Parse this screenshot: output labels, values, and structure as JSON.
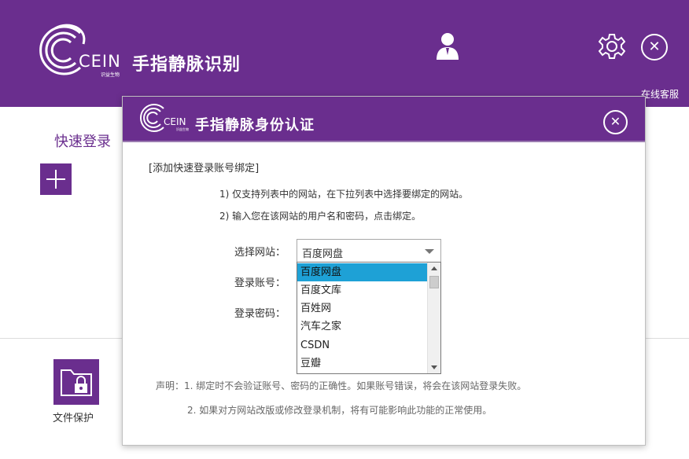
{
  "main": {
    "logo_text": "CEIN",
    "logo_sub": "识益生物",
    "title": "手指静脉识别",
    "online_service": "在线客服",
    "quick_login": "快速登录",
    "file_protection": "文件保护"
  },
  "modal": {
    "logo_text": "CEIN",
    "logo_sub": "识益生物",
    "title": "手指静脉身份认证",
    "section_title": "[添加快速登录账号绑定]",
    "instructions": [
      "1) 仅支持列表中的网站，在下拉列表中选择要绑定的网站。",
      "2) 输入您在该网站的用户名和密码，点击绑定。"
    ],
    "form": {
      "site_label": "选择网站：",
      "account_label": "登录账号：",
      "password_label": "登录密码：",
      "site_selected": "百度网盘",
      "site_options": [
        "百度网盘",
        "百度文库",
        "百姓网",
        "汽车之家",
        "CSDN",
        "豆瓣"
      ]
    },
    "notes": [
      "声明：1. 绑定时不会验证账号、密码的正确性。如果账号错误，将会在该网站登录失败。",
      "2. 如果对方网站改版或修改登录机制，将有可能影响此功能的正常使用。"
    ]
  },
  "colors": {
    "brand_purple": "#6a2e8e",
    "selection_blue": "#1ea1d6"
  },
  "icons": [
    "cein-logo-icon",
    "user-icon",
    "gear-icon",
    "close-icon",
    "plus-icon",
    "folder-lock-icon"
  ]
}
